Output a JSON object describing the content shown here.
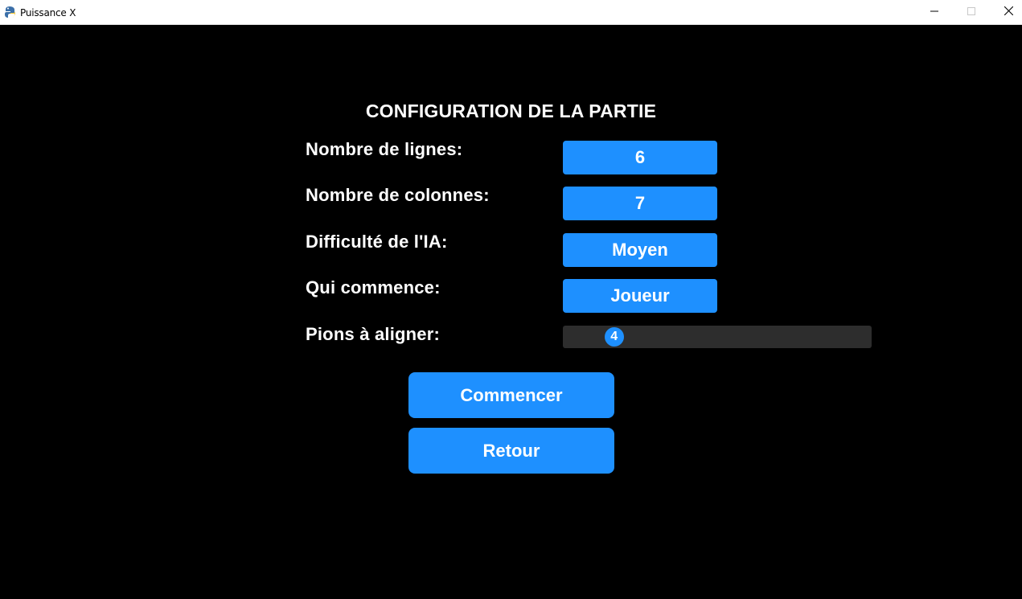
{
  "window": {
    "title": "Puissance X",
    "icon": "pygame-snake-icon",
    "controls": {
      "minimize_icon": "minimize-icon",
      "maximize_icon": "maximize-icon",
      "close_icon": "close-icon"
    }
  },
  "config": {
    "heading": "CONFIGURATION DE LA PARTIE",
    "rows_label": "Nombre de lignes:",
    "rows_value": "6",
    "cols_label": "Nombre de colonnes:",
    "cols_value": "7",
    "ai_label": "Difficulté de l'IA:",
    "ai_value": "Moyen",
    "first_label": "Qui commence:",
    "first_value": "Joueur",
    "align_label": "Pions à aligner:",
    "align_value": "4",
    "align_fraction": 0.166
  },
  "actions": {
    "start_label": "Commencer",
    "back_label": "Retour"
  },
  "colors": {
    "background": "#000000",
    "accent": "#1e90ff",
    "slider_track": "#2d2d2d",
    "text": "#ffffff"
  }
}
